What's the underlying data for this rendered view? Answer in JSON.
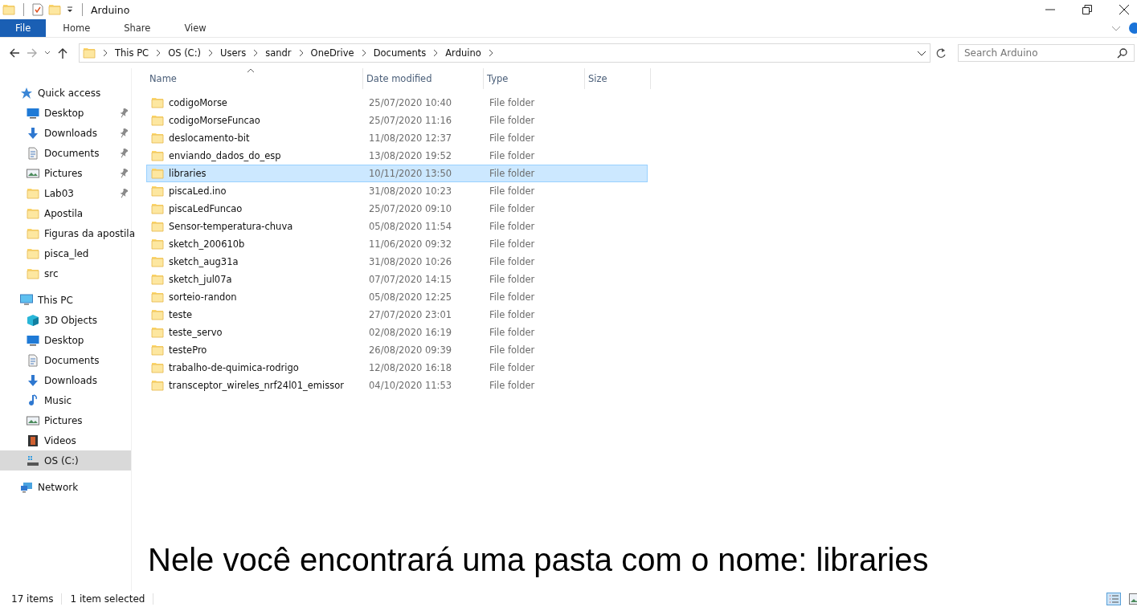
{
  "window": {
    "title": "Arduino"
  },
  "ribbon_tabs": [
    {
      "label": "File",
      "selected": true
    },
    {
      "label": "Home",
      "selected": false
    },
    {
      "label": "Share",
      "selected": false
    },
    {
      "label": "View",
      "selected": false
    }
  ],
  "address": {
    "crumbs": [
      "This PC",
      "OS (C:)",
      "Users",
      "sandr",
      "OneDrive",
      "Documents",
      "Arduino"
    ]
  },
  "search": {
    "placeholder": "Search Arduino"
  },
  "sidebar": {
    "items": [
      {
        "label": "Quick access",
        "kind": "star",
        "section": true,
        "pinned": false,
        "selected": false
      },
      {
        "label": "Desktop",
        "kind": "desktop",
        "section": false,
        "pinned": true,
        "selected": false
      },
      {
        "label": "Downloads",
        "kind": "downloads",
        "section": false,
        "pinned": true,
        "selected": false
      },
      {
        "label": "Documents",
        "kind": "documents",
        "section": false,
        "pinned": true,
        "selected": false
      },
      {
        "label": "Pictures",
        "kind": "pictures",
        "section": false,
        "pinned": true,
        "selected": false
      },
      {
        "label": "Lab03",
        "kind": "folder",
        "section": false,
        "pinned": true,
        "selected": false
      },
      {
        "label": "Apostila",
        "kind": "folder",
        "section": false,
        "pinned": false,
        "selected": false
      },
      {
        "label": "Figuras da apostila",
        "kind": "folder",
        "section": false,
        "pinned": false,
        "selected": false
      },
      {
        "label": "pisca_led",
        "kind": "folder",
        "section": false,
        "pinned": false,
        "selected": false
      },
      {
        "label": "src",
        "kind": "folder",
        "section": false,
        "pinned": false,
        "selected": false
      },
      {
        "label": "This PC",
        "kind": "pc",
        "section": true,
        "pinned": false,
        "selected": false
      },
      {
        "label": "3D Objects",
        "kind": "cube",
        "section": false,
        "pinned": false,
        "selected": false
      },
      {
        "label": "Desktop",
        "kind": "desktop",
        "section": false,
        "pinned": false,
        "selected": false
      },
      {
        "label": "Documents",
        "kind": "documents",
        "section": false,
        "pinned": false,
        "selected": false
      },
      {
        "label": "Downloads",
        "kind": "downloads",
        "section": false,
        "pinned": false,
        "selected": false
      },
      {
        "label": "Music",
        "kind": "music",
        "section": false,
        "pinned": false,
        "selected": false
      },
      {
        "label": "Pictures",
        "kind": "pictures",
        "section": false,
        "pinned": false,
        "selected": false
      },
      {
        "label": "Videos",
        "kind": "videos",
        "section": false,
        "pinned": false,
        "selected": false
      },
      {
        "label": "OS (C:)",
        "kind": "drive",
        "section": false,
        "pinned": false,
        "selected": true
      },
      {
        "label": "Network",
        "kind": "network",
        "section": true,
        "pinned": false,
        "selected": false
      }
    ]
  },
  "table": {
    "columns": [
      "Name",
      "Date modified",
      "Type",
      "Size"
    ],
    "rows": [
      {
        "name": "codigoMorse",
        "date": "25/07/2020 10:40",
        "type": "File folder",
        "selected": false
      },
      {
        "name": "codigoMorseFuncao",
        "date": "25/07/2020 11:16",
        "type": "File folder",
        "selected": false
      },
      {
        "name": "deslocamento-bit",
        "date": "11/08/2020 12:37",
        "type": "File folder",
        "selected": false
      },
      {
        "name": "enviando_dados_do_esp",
        "date": "13/08/2020 19:52",
        "type": "File folder",
        "selected": false
      },
      {
        "name": "libraries",
        "date": "10/11/2020 13:50",
        "type": "File folder",
        "selected": true
      },
      {
        "name": "piscaLed.ino",
        "date": "31/08/2020 10:23",
        "type": "File folder",
        "selected": false
      },
      {
        "name": "piscaLedFuncao",
        "date": "25/07/2020 09:10",
        "type": "File folder",
        "selected": false
      },
      {
        "name": "Sensor-temperatura-chuva",
        "date": "05/08/2020 11:54",
        "type": "File folder",
        "selected": false
      },
      {
        "name": "sketch_200610b",
        "date": "11/06/2020 09:32",
        "type": "File folder",
        "selected": false
      },
      {
        "name": "sketch_aug31a",
        "date": "31/08/2020 10:26",
        "type": "File folder",
        "selected": false
      },
      {
        "name": "sketch_jul07a",
        "date": "07/07/2020 14:15",
        "type": "File folder",
        "selected": false
      },
      {
        "name": "sorteio-randon",
        "date": "05/08/2020 12:25",
        "type": "File folder",
        "selected": false
      },
      {
        "name": "teste",
        "date": "27/07/2020 23:01",
        "type": "File folder",
        "selected": false
      },
      {
        "name": "teste_servo",
        "date": "02/08/2020 16:19",
        "type": "File folder",
        "selected": false
      },
      {
        "name": "testePro",
        "date": "26/08/2020 09:39",
        "type": "File folder",
        "selected": false
      },
      {
        "name": "trabalho-de-quimica-rodrigo",
        "date": "12/08/2020 16:18",
        "type": "File folder",
        "selected": false
      },
      {
        "name": "transceptor_wireles_nrf24l01_emissor",
        "date": "04/10/2020 11:53",
        "type": "File folder",
        "selected": false
      }
    ]
  },
  "caption": "Nele você encontrará uma pasta com o nome: libraries",
  "status_bar": {
    "item_count": "17 items",
    "selection": "1 item selected"
  }
}
